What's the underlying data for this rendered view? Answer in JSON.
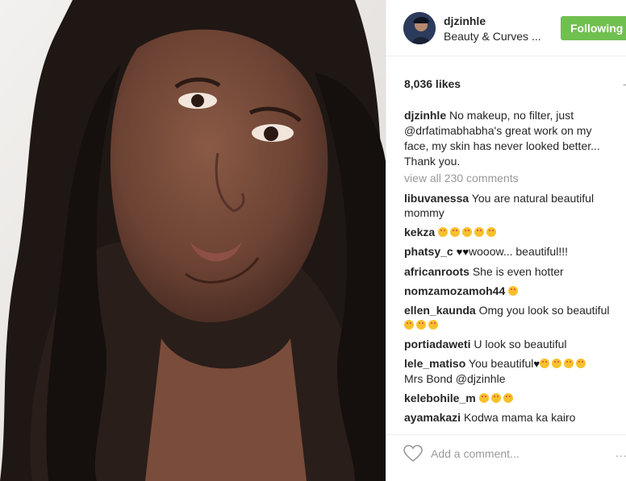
{
  "post": {
    "username": "djzinhle",
    "location": "Beauty & Curves ...",
    "follow_label": "Following",
    "likes": "8,036 likes",
    "likes_more": "-",
    "caption": {
      "user": "djzinhle",
      "text_before": " No makeup, no filter, just ",
      "mention": "@drfatimabhabha",
      "text_after": "'s great work on my face, my skin has never looked better... Thank you."
    },
    "view_all": "view all 230 comments",
    "comments": [
      {
        "user": "libuvanessa",
        "text": "You are natural beautiful mommy",
        "emoji_after": 0
      },
      {
        "user": "kekza",
        "text": "",
        "emoji_after": 5
      },
      {
        "user": "phatsy_c",
        "text": "wooow... beautiful!!!",
        "hearts_before": "♥♥"
      },
      {
        "user": "africanroots",
        "text": "She is even hotter",
        "emoji_after": 0
      },
      {
        "user": "nomzamozamoh44",
        "text": "",
        "emoji_after": 1
      },
      {
        "user": "ellen_kaunda",
        "text": "Omg you look so beautiful",
        "emoji_after": 3
      },
      {
        "user": "portiadaweti",
        "text": "U look so beautiful",
        "emoji_after": 0
      },
      {
        "user": "lele_matiso",
        "text": "You beautiful",
        "suffix": "♥",
        "emoji_after": 4,
        "text2": "Mrs Bond @djzinhle"
      },
      {
        "user": "kelebohile_m",
        "text": "",
        "emoji_after": 3
      },
      {
        "user": "ayamakazi",
        "text": "Kodwa mama ka kairo",
        "emoji_after": 0
      }
    ],
    "comment_placeholder": "Add a comment...",
    "more_dots": "..."
  },
  "icons": {
    "like": "heart-outline-icon",
    "more": "more-options-icon"
  },
  "colors": {
    "follow_bg": "#70c050",
    "muted_text": "#999999",
    "text": "#262626"
  }
}
